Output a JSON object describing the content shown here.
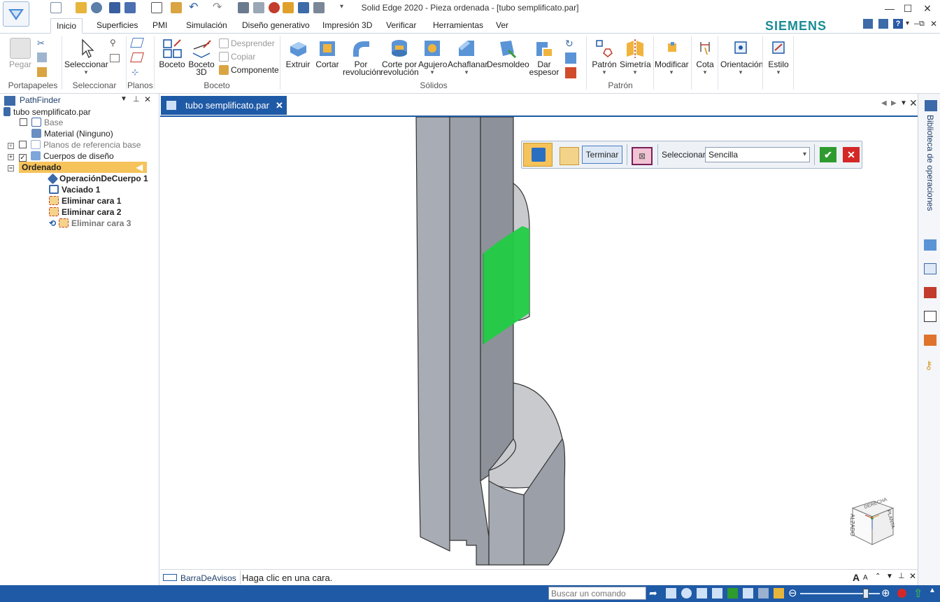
{
  "window": {
    "title": "Solid Edge 2020 - Pieza ordenada - [tubo semplificato.par]",
    "brand": "SIEMENS",
    "minimize": "—",
    "maximize": "☐",
    "close": "✕",
    "inner_minimize": "–",
    "inner_restore": "⧉",
    "inner_close": "✕"
  },
  "tabs": [
    "Inicio",
    "Superficies",
    "PMI",
    "Simulación",
    "Diseño generativo",
    "Impresión 3D",
    "Verificar",
    "Herramientas",
    "Ver"
  ],
  "ribbon": {
    "clipboard": {
      "paste": "Pegar",
      "group": "Portapapeles"
    },
    "select": {
      "select": "Seleccionar",
      "group": "Seleccionar"
    },
    "planes": {
      "group": "Planos"
    },
    "sketch": {
      "sketch": "Boceto",
      "sketch3d_line1": "Boceto",
      "sketch3d_line2": "3D",
      "detach": "Desprender",
      "copy": "Copiar",
      "component": "Componente",
      "group": "Boceto"
    },
    "solids": {
      "extrude": "Extruir",
      "cut": "Cortar",
      "revolve_l1": "Por",
      "revolve_l2": "revolución",
      "revcut_l1": "Corte por",
      "revcut_l2": "revolución",
      "hole": "Agujero",
      "chamfer": "Achaflanar",
      "draft": "Desmoldeo",
      "thicken_l1": "Dar",
      "thicken_l2": "espesor",
      "group": "Sólidos"
    },
    "pattern": {
      "pattern": "Patrón",
      "mirror": "Simetría",
      "group": "Patrón"
    },
    "modify": "Modificar",
    "dimension": "Cota",
    "orientation": "Orientación",
    "style": "Estilo"
  },
  "pathfinder": {
    "title": "PathFinder",
    "root": "tubo semplificato.par",
    "items": [
      {
        "label": "Base"
      },
      {
        "label": "Material (Ninguno)"
      },
      {
        "label": "Planos de referencia base"
      },
      {
        "label": "Cuerpos de diseño"
      },
      {
        "label": "Ordenado"
      },
      {
        "label": "OperaciónDeCuerpo 1"
      },
      {
        "label": "Vaciado 1"
      },
      {
        "label": "Eliminar cara 1"
      },
      {
        "label": "Eliminar cara 2"
      },
      {
        "label": "Eliminar cara 3"
      }
    ]
  },
  "document_tab": {
    "label": "tubo semplificato.par"
  },
  "command_bar": {
    "finish": "Terminar",
    "select_label": "Seleccionar:",
    "select_value": "Sencilla"
  },
  "view_cube": {
    "front": "ALZADO",
    "top": "DERECHA",
    "side": "PLANTA"
  },
  "notice_bar": {
    "label": "BarraDeAvisos",
    "message": "Haga clic en una cara."
  },
  "status": {
    "search_placeholder": "Buscar un comando"
  },
  "right_panel": {
    "label": "Biblioteca de operaciones"
  },
  "colors": {
    "accent": "#1f5aa6",
    "selection": "#22cc44",
    "brand": "#1a8c95",
    "ordered_highlight": "#f6c35b"
  }
}
